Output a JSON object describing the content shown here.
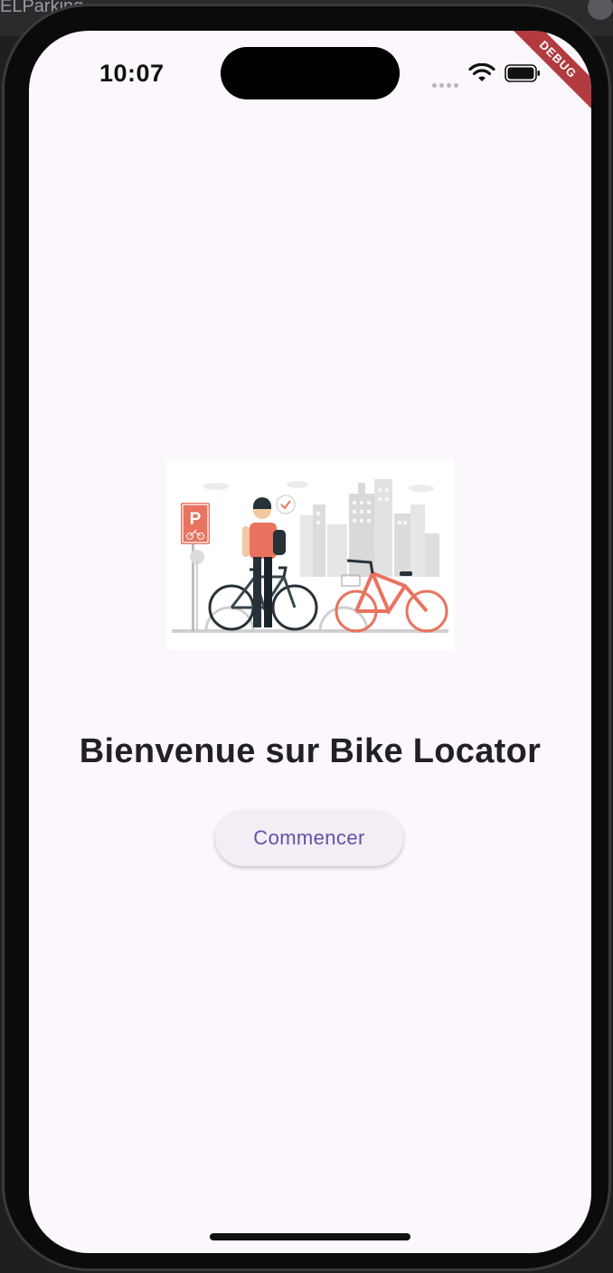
{
  "background_app": {
    "title_fragment": "ELParking"
  },
  "status_bar": {
    "time": "10:07",
    "wifi_icon": "wifi-icon",
    "battery_icon": "battery-icon",
    "signal_icon": "signal-dots-icon"
  },
  "debug_banner": {
    "label": "DEBUG"
  },
  "hero_image": {
    "description_icon": "bike-parking-illustration",
    "parking_sign_letter": "P"
  },
  "main": {
    "title": "Bienvenue sur Bike Locator",
    "start_button_label": "Commencer"
  },
  "colors": {
    "screen_bg": "#fcf7fd",
    "button_bg": "#f3edf6",
    "button_text": "#6650a4",
    "accent_coral": "#e8735f",
    "debug_red": "#b23b3f",
    "title_text": "#221f27"
  }
}
